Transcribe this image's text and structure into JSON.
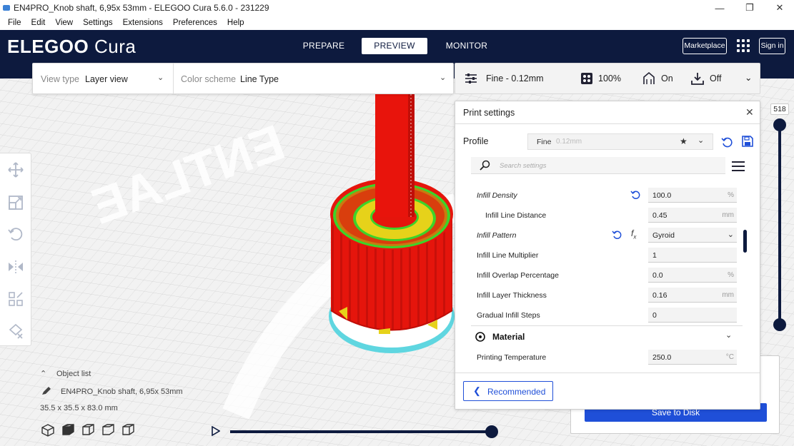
{
  "window": {
    "title": "EN4PRO_Knob  shaft, 6,95x 53mm - ELEGOO Cura 5.6.0 - 231229",
    "minimize": "—",
    "restore": "❐",
    "close": "✕"
  },
  "menu": [
    "File",
    "Edit",
    "View",
    "Settings",
    "Extensions",
    "Preferences",
    "Help"
  ],
  "header": {
    "logo_main": "ELEGOO",
    "logo_sub": "Cura",
    "tabs": [
      {
        "label": "PREPARE",
        "active": false
      },
      {
        "label": "PREVIEW",
        "active": true
      },
      {
        "label": "MONITOR",
        "active": false
      }
    ],
    "marketplace": "Marketplace",
    "signin": "Sign in"
  },
  "viewbar": {
    "view_type_label": "View type",
    "view_type_value": "Layer view",
    "color_scheme_label": "Color scheme",
    "color_scheme_value": "Line Type"
  },
  "printbar": {
    "profile": "Fine - 0.12mm",
    "infill": "100%",
    "support": "On",
    "adhesion": "Off"
  },
  "object_list": {
    "title": "Object list",
    "object_name": "EN4PRO_Knob  shaft, 6,95x 53mm",
    "dimensions": "35.5 x 35.5 x 83.0 mm"
  },
  "layer_slider": {
    "top_value": "518"
  },
  "playback": {
    "progress": 1.0
  },
  "save_panel": {
    "button": "Save to Disk"
  },
  "print_settings": {
    "title": "Print settings",
    "profile_label": "Profile",
    "profile_name": "Fine",
    "profile_layer": "0.12mm",
    "search_placeholder": "Search settings",
    "rows": [
      {
        "label": "Infill Density",
        "italic": true,
        "indent": false,
        "value": "100.0",
        "unit": "%",
        "reset": true,
        "fx": false,
        "dropdown": false
      },
      {
        "label": "Infill Line Distance",
        "italic": false,
        "indent": true,
        "value": "0.45",
        "unit": "mm",
        "reset": false,
        "fx": false,
        "dropdown": false
      },
      {
        "label": "Infill Pattern",
        "italic": true,
        "indent": false,
        "value": "Gyroid",
        "unit": "",
        "reset": true,
        "fx": true,
        "dropdown": true
      },
      {
        "label": "Infill Line Multiplier",
        "italic": false,
        "indent": false,
        "value": "1",
        "unit": "",
        "reset": false,
        "fx": false,
        "dropdown": false
      },
      {
        "label": "Infill Overlap Percentage",
        "italic": false,
        "indent": false,
        "value": "0.0",
        "unit": "%",
        "reset": false,
        "fx": false,
        "dropdown": false
      },
      {
        "label": "Infill Layer Thickness",
        "italic": false,
        "indent": false,
        "value": "0.16",
        "unit": "mm",
        "reset": false,
        "fx": false,
        "dropdown": false
      },
      {
        "label": "Gradual Infill Steps",
        "italic": false,
        "indent": false,
        "value": "0",
        "unit": "",
        "reset": false,
        "fx": false,
        "dropdown": false
      }
    ],
    "section_material": "Material",
    "material_rows": [
      {
        "label": "Printing Temperature",
        "value": "250.0",
        "unit": "°C"
      }
    ],
    "recommended": "Recommended",
    "fx_symbol": "f",
    "fx_sub": "x"
  },
  "colors": {
    "brand_navy": "#0d1a3e",
    "accent_blue": "#1f4fd8",
    "model_red": "#e8140c",
    "infill_yellow": "#e6d21a",
    "wall_green": "#3dd32a",
    "skirt_cyan": "#5fd6e0"
  }
}
